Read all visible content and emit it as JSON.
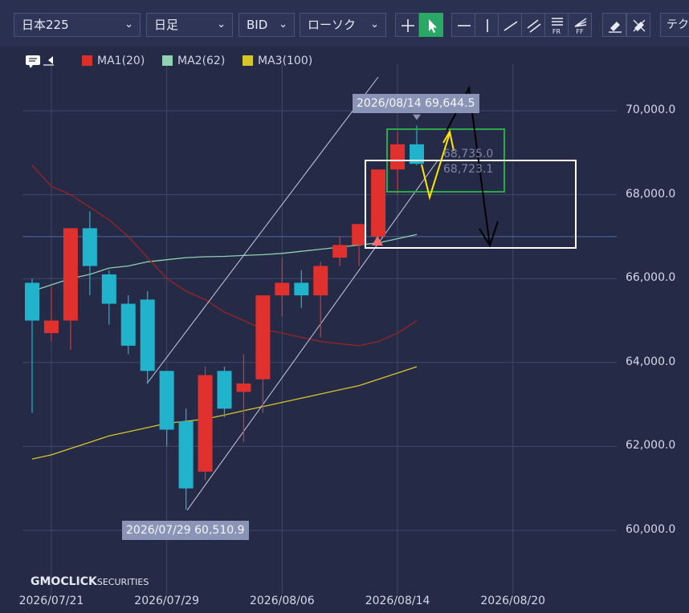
{
  "toolbar": {
    "symbol": "日本225",
    "period": "日足",
    "price_type": "BID",
    "chart_type": "ローソク",
    "technical_label": "テクニ",
    "tools": [
      {
        "name": "crosshair",
        "icon": "plus-icon"
      },
      {
        "name": "pointer",
        "icon": "cursor-arrow-icon",
        "active": true
      },
      {
        "name": "horizontal-line",
        "icon": "horizontal-line-icon"
      },
      {
        "name": "vertical-line",
        "icon": "vertical-line-icon"
      },
      {
        "name": "trend-line",
        "icon": "trend-line-icon"
      },
      {
        "name": "channel",
        "icon": "parallel-lines-icon"
      },
      {
        "name": "fibonacci-retracement",
        "icon": "fibonacci-retracement-icon",
        "sub": "FR"
      },
      {
        "name": "fibonacci-fan",
        "icon": "fibonacci-fan-icon",
        "sub": "FF"
      },
      {
        "name": "eraser",
        "icon": "eraser-icon"
      },
      {
        "name": "erase-all",
        "icon": "eraser-all-icon"
      }
    ]
  },
  "legend": {
    "ma1": {
      "label": "MA1(20)",
      "color": "#d9302c"
    },
    "ma2": {
      "label": "MA2(62)",
      "color": "#8fd1b0"
    },
    "ma3": {
      "label": "MA3(100)",
      "color": "#d7c52a"
    }
  },
  "colors": {
    "background": "#252b47",
    "up": "#e0312f",
    "down": "#22b3cc",
    "grid": "#3f4768",
    "annotation_box_green": "#2aa84a",
    "annotation_box_white": "#ffffff",
    "arrow_yellow": "#ffe600",
    "arrow_black": "#000000"
  },
  "callouts": {
    "high": "2026/08/14 69,644.5",
    "low": "2026/07/29 60,510.9"
  },
  "last_price_labels": [
    "68,735.0",
    "68,723.1"
  ],
  "watermark": {
    "main": "GMOCLICK",
    "sub": "SECURITIES"
  },
  "chart_data": {
    "type": "candlestick",
    "y_axis": {
      "min": 59500,
      "max": 71200,
      "ticks": [
        "60,000.0",
        "62,000.0",
        "64,000.0",
        "66,000.0",
        "68,000.0",
        "70,000.0"
      ],
      "tick_values": [
        60000,
        62000,
        64000,
        66000,
        68000,
        70000
      ]
    },
    "x_axis": {
      "tick_labels": [
        "2026/07/21",
        "2026/07/29",
        "2026/08/06",
        "2026/08/14",
        "2026/08/20"
      ],
      "tick_index": [
        1,
        7,
        13,
        19,
        25
      ]
    },
    "candles": [
      {
        "o": 65900,
        "h": 66000,
        "l": 62800,
        "c": 65000
      },
      {
        "o": 64700,
        "h": 65800,
        "l": 64500,
        "c": 65000
      },
      {
        "o": 65000,
        "h": 67200,
        "l": 64300,
        "c": 67200
      },
      {
        "o": 67200,
        "h": 67600,
        "l": 65600,
        "c": 66300
      },
      {
        "o": 66100,
        "h": 66200,
        "l": 64900,
        "c": 65400
      },
      {
        "o": 65400,
        "h": 65600,
        "l": 64200,
        "c": 64400
      },
      {
        "o": 65500,
        "h": 65700,
        "l": 63500,
        "c": 63800
      },
      {
        "o": 63800,
        "h": 63800,
        "l": 62000,
        "c": 62400
      },
      {
        "o": 62600,
        "h": 62900,
        "l": 60500,
        "c": 61000
      },
      {
        "o": 61400,
        "h": 63900,
        "l": 61200,
        "c": 63700
      },
      {
        "o": 63800,
        "h": 63900,
        "l": 62700,
        "c": 62900
      },
      {
        "o": 63300,
        "h": 64200,
        "l": 62100,
        "c": 63500
      },
      {
        "o": 63600,
        "h": 65600,
        "l": 62800,
        "c": 65600
      },
      {
        "o": 65600,
        "h": 66500,
        "l": 65100,
        "c": 65900
      },
      {
        "o": 65900,
        "h": 66200,
        "l": 65300,
        "c": 65600
      },
      {
        "o": 65600,
        "h": 66400,
        "l": 64600,
        "c": 66300
      },
      {
        "o": 66500,
        "h": 67000,
        "l": 66300,
        "c": 66800
      },
      {
        "o": 66800,
        "h": 67200,
        "l": 66300,
        "c": 67300
      },
      {
        "o": 67000,
        "h": 68300,
        "l": 66900,
        "c": 68600
      },
      {
        "o": 68600,
        "h": 69500,
        "l": 68000,
        "c": 69200
      },
      {
        "o": 69200,
        "h": 69644.5,
        "l": 68700,
        "c": 68735
      }
    ],
    "ma1": [
      68700,
      68200,
      68000,
      67700,
      67400,
      67000,
      66500,
      66000,
      65700,
      65500,
      65200,
      65000,
      64800,
      64700,
      64600,
      64500,
      64450,
      64400,
      64500,
      64700,
      65000
    ],
    "ma2": [
      65700,
      65850,
      66000,
      66100,
      66250,
      66300,
      66400,
      66450,
      66500,
      66520,
      66530,
      66550,
      66570,
      66600,
      66650,
      66700,
      66750,
      66800,
      66850,
      66950,
      67050
    ],
    "ma3": [
      61700,
      61800,
      61950,
      62100,
      62250,
      62350,
      62450,
      62550,
      62600,
      62650,
      62750,
      62850,
      62950,
      63050,
      63150,
      63250,
      63350,
      63450,
      63600,
      63750,
      63900
    ]
  }
}
